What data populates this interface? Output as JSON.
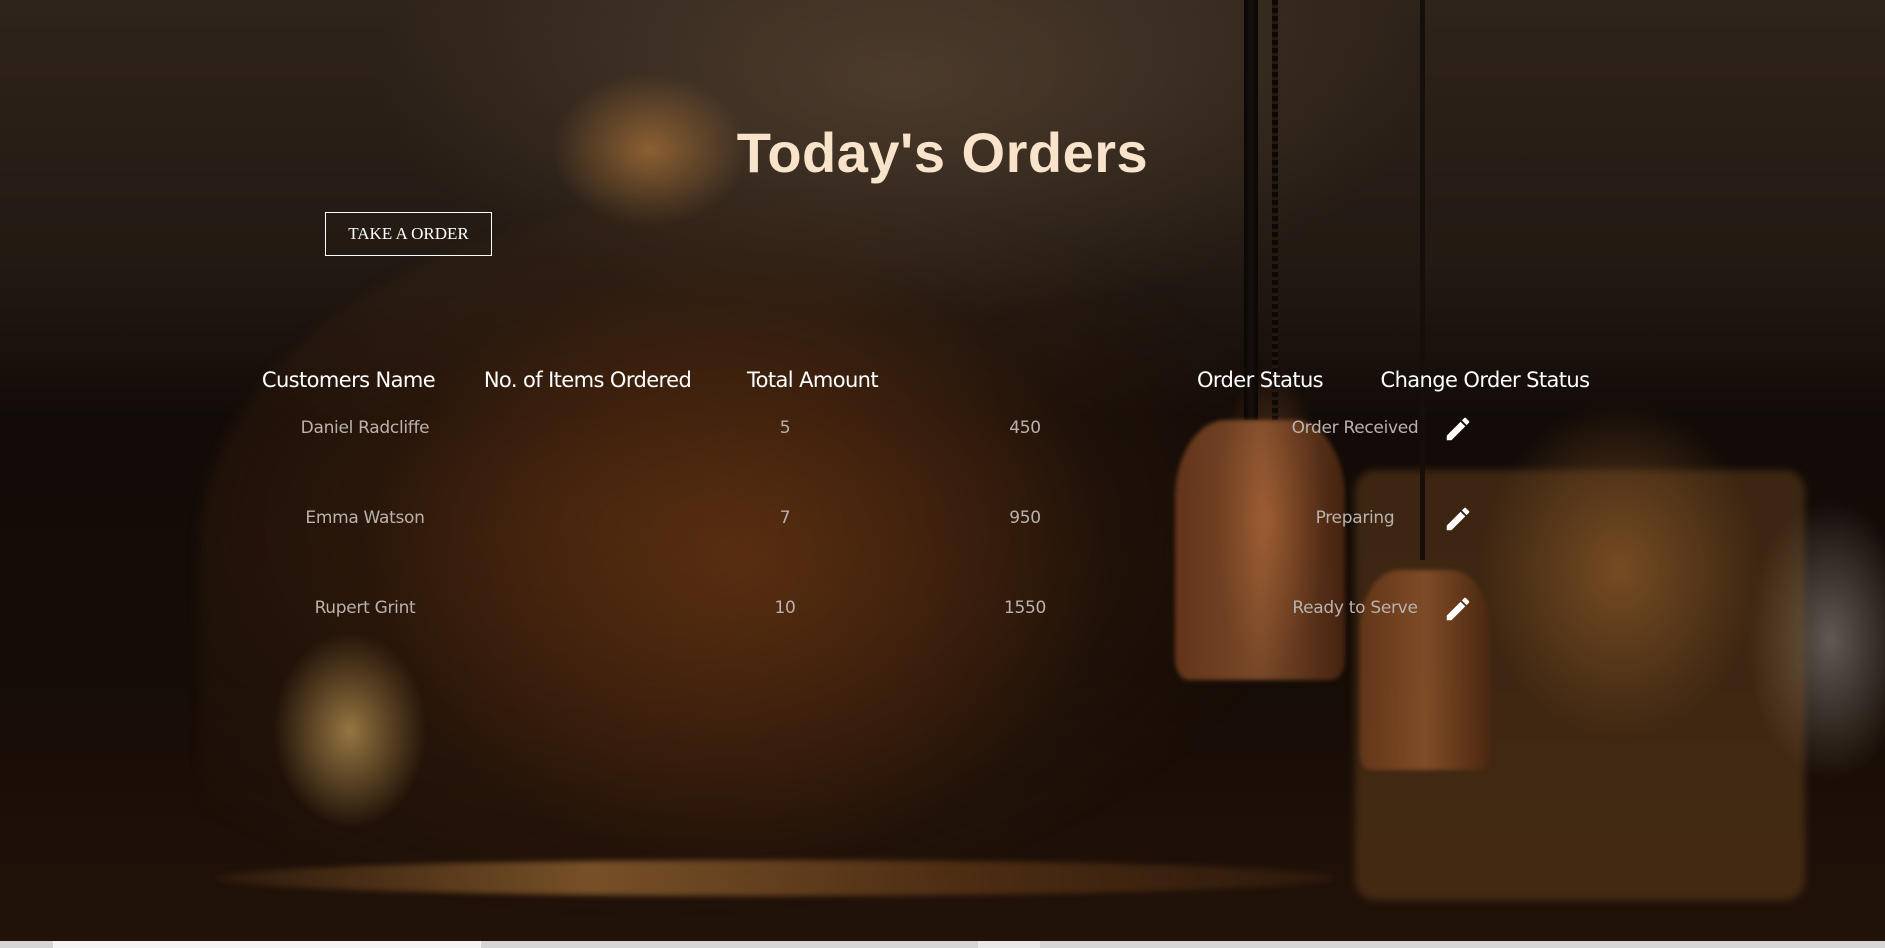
{
  "page": {
    "title": "Today's Orders"
  },
  "actions": {
    "take_order_label": "TAKE A ORDER"
  },
  "table": {
    "headers": {
      "customer_name": "Customers Name",
      "items_ordered": "No. of Items Ordered",
      "total_amount": "Total Amount",
      "order_status": "Order Status",
      "change_status": "Change Order Status"
    },
    "rows": [
      {
        "customer_name": "Daniel Radcliffe",
        "items_ordered": "5",
        "total_amount": "450",
        "order_status": "Order Received",
        "edit_icon": "pencil-icon"
      },
      {
        "customer_name": "Emma Watson",
        "items_ordered": "7",
        "total_amount": "950",
        "order_status": "Preparing",
        "edit_icon": "pencil-icon"
      },
      {
        "customer_name": "Rupert Grint",
        "items_ordered": "10",
        "total_amount": "1550",
        "order_status": "Ready to Serve",
        "edit_icon": "pencil-icon"
      }
    ]
  },
  "colors": {
    "title": "#f9e4cb",
    "header_text": "#ffffff",
    "cell_text": "#b9b2ad",
    "button_border": "#ffffff"
  }
}
